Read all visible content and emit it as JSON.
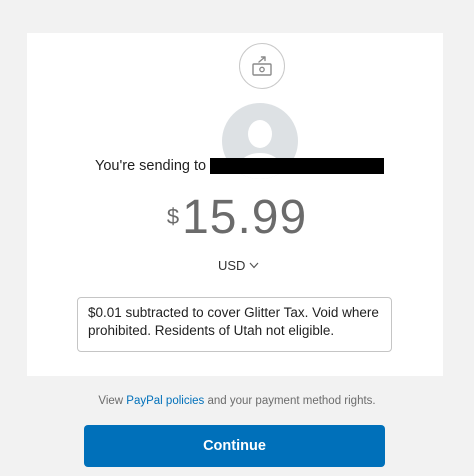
{
  "header": {
    "icon": "send-money-icon"
  },
  "recipient": {
    "label": "You're sending to",
    "name_redacted": true
  },
  "amount": {
    "symbol": "$",
    "value": "15.99"
  },
  "currency": {
    "selected": "USD"
  },
  "note": {
    "text": "$0.01 subtracted to cover Glitter Tax. Void where prohibited. Residents of Utah not eligible."
  },
  "footer": {
    "prefix": "View",
    "link": "PayPal policies",
    "suffix": "and your payment method rights."
  },
  "actions": {
    "continue_label": "Continue"
  },
  "colors": {
    "accent": "#0070ba",
    "background": "#f2f2f2"
  }
}
